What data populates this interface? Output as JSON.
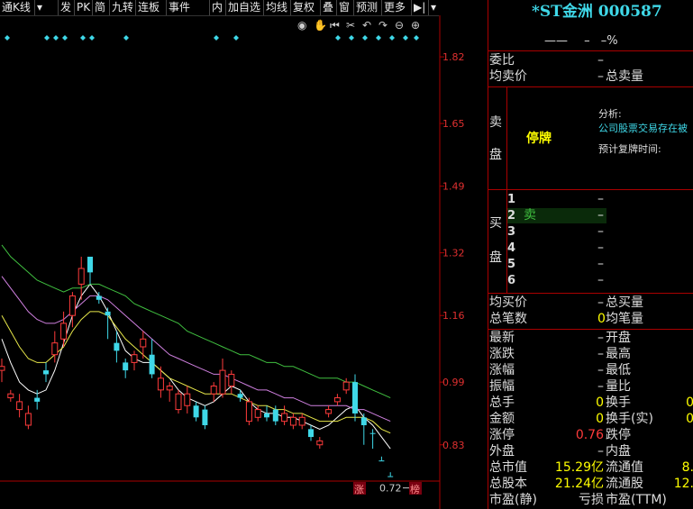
{
  "toolbar": {
    "items": [
      "通K线",
      "发",
      "PK",
      "简",
      "九转",
      "连板",
      "事件",
      "内",
      "加自选",
      "均线",
      "复权",
      "叠",
      "窗",
      "预测",
      "更多"
    ]
  },
  "chart": {
    "tools": [
      "eye-icon",
      "hand-icon",
      "rewind-icon",
      "scissors-icon",
      "undo-icon",
      "redo-icon",
      "zoom-out-icon",
      "zoom-in-icon"
    ],
    "y_ticks": [
      "1.82",
      "1.65",
      "1.49",
      "1.32",
      "1.16",
      "0.99",
      "0.83"
    ],
    "low_label": "0.72",
    "markers": [
      "涨",
      "榜"
    ]
  },
  "chart_data": {
    "type": "candlestick",
    "ylim": [
      0.68,
      1.88
    ],
    "y_ticks": [
      1.82,
      1.65,
      1.49,
      1.32,
      1.16,
      0.99,
      0.83
    ],
    "low_value": 0.72,
    "candles": [
      {
        "o": 1.03,
        "c": 1.02,
        "h": 1.05,
        "l": 0.99,
        "up": true
      },
      {
        "o": 0.96,
        "c": 0.95,
        "h": 0.97,
        "l": 0.94,
        "up": true
      },
      {
        "o": 0.94,
        "c": 0.92,
        "h": 0.96,
        "l": 0.9,
        "up": true
      },
      {
        "o": 0.91,
        "c": 0.88,
        "h": 0.93,
        "l": 0.87,
        "up": true
      },
      {
        "o": 0.94,
        "c": 0.95,
        "h": 0.97,
        "l": 0.92,
        "up": false
      },
      {
        "o": 1.01,
        "c": 1.02,
        "h": 1.04,
        "l": 0.99,
        "up": false
      },
      {
        "o": 1.09,
        "c": 1.06,
        "h": 1.12,
        "l": 1.04,
        "up": true
      },
      {
        "o": 1.14,
        "c": 1.1,
        "h": 1.17,
        "l": 1.08,
        "up": true
      },
      {
        "o": 1.21,
        "c": 1.16,
        "h": 1.22,
        "l": 1.13,
        "up": true
      },
      {
        "o": 1.28,
        "c": 1.24,
        "h": 1.31,
        "l": 1.2,
        "up": true
      },
      {
        "o": 1.27,
        "c": 1.31,
        "h": 1.31,
        "l": 1.24,
        "up": false
      },
      {
        "o": 1.2,
        "c": 1.21,
        "h": 1.22,
        "l": 1.19,
        "up": false
      },
      {
        "o": 1.16,
        "c": 1.17,
        "h": 1.18,
        "l": 1.1,
        "up": false
      },
      {
        "o": 1.07,
        "c": 1.09,
        "h": 1.12,
        "l": 1.04,
        "up": false
      },
      {
        "o": 1.04,
        "c": 1.02,
        "h": 1.05,
        "l": 1.0,
        "up": false
      },
      {
        "o": 1.04,
        "c": 1.06,
        "h": 1.07,
        "l": 1.02,
        "up": true
      },
      {
        "o": 1.08,
        "c": 1.1,
        "h": 1.12,
        "l": 1.05,
        "up": true
      },
      {
        "o": 1.06,
        "c": 1.01,
        "h": 1.1,
        "l": 1.0,
        "up": false
      },
      {
        "o": 1.0,
        "c": 0.97,
        "h": 1.03,
        "l": 0.95,
        "up": true
      },
      {
        "o": 0.98,
        "c": 0.97,
        "h": 0.99,
        "l": 0.94,
        "up": true
      },
      {
        "o": 0.92,
        "c": 0.96,
        "h": 0.97,
        "l": 0.91,
        "up": true
      },
      {
        "o": 0.96,
        "c": 0.93,
        "h": 0.98,
        "l": 0.91,
        "up": true
      },
      {
        "o": 0.93,
        "c": 0.9,
        "h": 0.94,
        "l": 0.89,
        "up": false
      },
      {
        "o": 0.92,
        "c": 0.88,
        "h": 0.93,
        "l": 0.87,
        "up": false
      },
      {
        "o": 0.96,
        "c": 0.98,
        "h": 0.99,
        "l": 0.94,
        "up": true
      },
      {
        "o": 1.02,
        "c": 0.96,
        "h": 1.05,
        "l": 0.95,
        "up": true
      },
      {
        "o": 0.98,
        "c": 1.01,
        "h": 1.02,
        "l": 0.96,
        "up": true
      },
      {
        "o": 0.96,
        "c": 0.95,
        "h": 0.97,
        "l": 0.94,
        "up": false
      },
      {
        "o": 0.94,
        "c": 0.89,
        "h": 0.95,
        "l": 0.88,
        "up": true
      },
      {
        "o": 0.9,
        "c": 0.92,
        "h": 0.93,
        "l": 0.89,
        "up": true
      },
      {
        "o": 0.91,
        "c": 0.9,
        "h": 0.93,
        "l": 0.89,
        "up": false
      },
      {
        "o": 0.92,
        "c": 0.89,
        "h": 0.93,
        "l": 0.88,
        "up": false
      },
      {
        "o": 0.89,
        "c": 0.91,
        "h": 0.93,
        "l": 0.88,
        "up": true
      },
      {
        "o": 0.88,
        "c": 0.9,
        "h": 0.91,
        "l": 0.87,
        "up": true
      },
      {
        "o": 0.9,
        "c": 0.88,
        "h": 0.91,
        "l": 0.87,
        "up": true
      },
      {
        "o": 0.87,
        "c": 0.85,
        "h": 0.88,
        "l": 0.84,
        "up": false
      },
      {
        "o": 0.84,
        "c": 0.83,
        "h": 0.85,
        "l": 0.82,
        "up": true
      },
      {
        "o": 0.91,
        "c": 0.92,
        "h": 0.93,
        "l": 0.9,
        "up": true
      },
      {
        "o": 0.94,
        "c": 0.95,
        "h": 0.96,
        "l": 0.93,
        "up": true
      },
      {
        "o": 0.99,
        "c": 0.97,
        "h": 1.0,
        "l": 0.96,
        "up": true
      },
      {
        "o": 0.99,
        "c": 0.91,
        "h": 1.01,
        "l": 0.89,
        "up": false
      },
      {
        "o": 0.9,
        "c": 0.88,
        "h": 0.91,
        "l": 0.83,
        "up": false
      },
      {
        "o": 0.86,
        "c": 0.86,
        "h": 0.87,
        "l": 0.82,
        "up": false
      },
      {
        "o": 0.79,
        "c": 0.79,
        "h": 0.8,
        "l": 0.79,
        "up": false
      },
      {
        "o": 0.75,
        "c": 0.75,
        "h": 0.76,
        "l": 0.75,
        "up": false
      }
    ],
    "ma": [
      {
        "color": "#ffffff",
        "values": [
          1.1,
          1.04,
          0.99,
          0.97,
          0.96,
          0.97,
          1.02,
          1.09,
          1.16,
          1.21,
          1.24,
          1.21,
          1.17,
          1.12,
          1.07,
          1.05,
          1.04,
          1.04,
          1.02,
          1.0,
          0.97,
          0.95,
          0.94,
          0.93,
          0.94,
          0.96,
          0.98,
          0.97,
          0.94,
          0.92,
          0.91,
          0.91,
          0.9,
          0.9,
          0.89,
          0.88,
          0.87,
          0.88,
          0.9,
          0.92,
          0.93,
          0.9,
          0.88,
          0.85,
          0.82
        ]
      },
      {
        "color": "#e8e84a",
        "values": [
          1.16,
          1.12,
          1.08,
          1.05,
          1.04,
          1.04,
          1.06,
          1.08,
          1.12,
          1.15,
          1.17,
          1.17,
          1.16,
          1.13,
          1.1,
          1.08,
          1.06,
          1.04,
          1.02,
          1.0,
          0.99,
          0.98,
          0.97,
          0.96,
          0.96,
          0.96,
          0.96,
          0.95,
          0.94,
          0.93,
          0.93,
          0.92,
          0.92,
          0.91,
          0.91,
          0.9,
          0.89,
          0.89,
          0.89,
          0.9,
          0.9,
          0.9,
          0.89,
          0.87,
          0.86
        ]
      },
      {
        "color": "#d080e0",
        "values": [
          1.26,
          1.23,
          1.2,
          1.17,
          1.15,
          1.14,
          1.14,
          1.15,
          1.17,
          1.19,
          1.21,
          1.21,
          1.2,
          1.18,
          1.16,
          1.14,
          1.12,
          1.1,
          1.08,
          1.06,
          1.05,
          1.04,
          1.03,
          1.02,
          1.01,
          1.01,
          1.0,
          0.99,
          0.98,
          0.97,
          0.97,
          0.96,
          0.95,
          0.95,
          0.94,
          0.93,
          0.93,
          0.93,
          0.93,
          0.93,
          0.92,
          0.92,
          0.91,
          0.9,
          0.89
        ]
      },
      {
        "color": "#40c040",
        "values": [
          1.34,
          1.31,
          1.29,
          1.27,
          1.25,
          1.24,
          1.23,
          1.22,
          1.23,
          1.23,
          1.24,
          1.24,
          1.23,
          1.22,
          1.21,
          1.19,
          1.18,
          1.17,
          1.16,
          1.15,
          1.14,
          1.12,
          1.11,
          1.1,
          1.09,
          1.08,
          1.07,
          1.06,
          1.06,
          1.05,
          1.04,
          1.04,
          1.03,
          1.03,
          1.02,
          1.01,
          1.0,
          1.0,
          1.0,
          0.99,
          0.99,
          0.98,
          0.97,
          0.96,
          0.95
        ]
      }
    ]
  },
  "quote": {
    "title": "*ST金洲 000587",
    "price": "——",
    "change": "–",
    "pct": "–%",
    "weibi_label": "委比",
    "weibi_val": "–",
    "avg_sell_label": "均卖价",
    "avg_sell_val": "–",
    "total_sell_label": "总卖量",
    "sell_side": [
      "卖",
      "盘"
    ],
    "suspend": "停牌",
    "analysis_label": "分析:",
    "analysis_text": "公司股票交易存在被",
    "resume_label": "预计复牌时间:",
    "buy_side": [
      "买",
      "盘"
    ],
    "buy_rows": [
      {
        "lvl": "1",
        "tag": "",
        "val": "–"
      },
      {
        "lvl": "2",
        "tag": "卖",
        "val": "–"
      },
      {
        "lvl": "3",
        "tag": "",
        "val": "–"
      },
      {
        "lvl": "4",
        "tag": "",
        "val": "–"
      },
      {
        "lvl": "5",
        "tag": "",
        "val": "–"
      },
      {
        "lvl": "6",
        "tag": "",
        "val": "–"
      }
    ],
    "avg_buy_label": "均买价",
    "avg_buy_val": "–",
    "total_buy_label": "总买量",
    "total_trades_label": "总笔数",
    "total_trades_val": "0",
    "avg_vol_label": "均笔量",
    "stats": [
      {
        "l": "最新",
        "v": "–",
        "l2": "开盘",
        "v2": ""
      },
      {
        "l": "涨跌",
        "v": "–",
        "l2": "最高",
        "v2": ""
      },
      {
        "l": "涨幅",
        "v": "–",
        "l2": "最低",
        "v2": ""
      },
      {
        "l": "振幅",
        "v": "–",
        "l2": "量比",
        "v2": ""
      },
      {
        "l": "总手",
        "v": "0",
        "l2": "换手",
        "v2": "0"
      },
      {
        "l": "金额",
        "v": "0",
        "l2": "换手(实)",
        "v2": "0"
      },
      {
        "l": "涨停",
        "v": "0.76",
        "l2": "跌停",
        "v2": ""
      },
      {
        "l": "外盘",
        "v": "–",
        "l2": "内盘",
        "v2": ""
      },
      {
        "l": "总市值",
        "v": "15.29亿",
        "l2": "流通值",
        "v2": "8."
      },
      {
        "l": "总股本",
        "v": "21.24亿",
        "l2": "流通股",
        "v2": "12."
      },
      {
        "l": "市盈(静)",
        "v": "亏损",
        "l2": "市盈(TTM)",
        "v2": ""
      }
    ]
  }
}
